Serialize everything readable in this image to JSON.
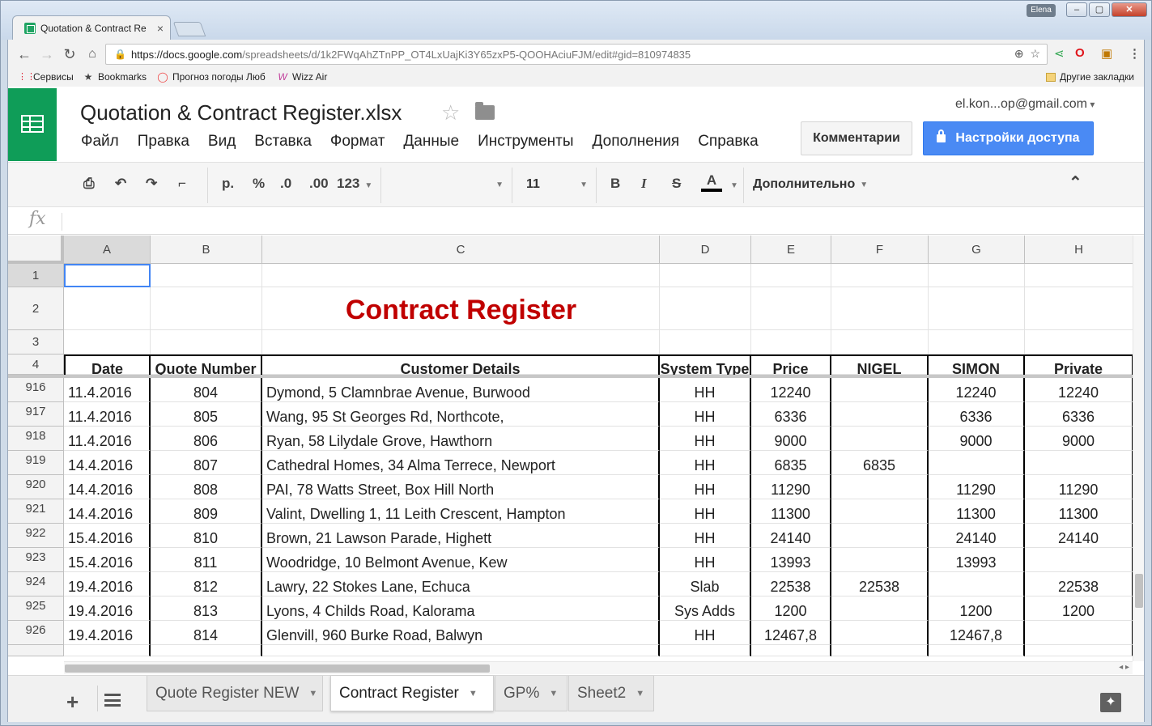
{
  "browser": {
    "tab_title": "Quotation & Contract Re",
    "tab_close": "×",
    "user_badge": "Elena",
    "min": "–",
    "max": "▢",
    "close": "✕",
    "url_host": "https://docs.google.com",
    "url_path": "/spreadsheets/d/1k2FWqAhZTnPP_OT4LxUajKi3Y65zxP5-QOOHAciuFJM/edit#gid=810974835",
    "bookmarks": [
      {
        "label": "Сервисы",
        "icon": "apps-grid-icon"
      },
      {
        "label": "Bookmarks",
        "icon": "star-icon"
      },
      {
        "label": "Прогноз погоды Люб",
        "icon": "circle-icon"
      },
      {
        "label": "Wizz Air",
        "icon": "w-icon"
      }
    ],
    "other_bookmarks": "Другие закладки"
  },
  "doc": {
    "title": "Quotation & Contract Register.xlsx",
    "account": "el.kon...op@gmail.com",
    "menu": [
      "Файл",
      "Правка",
      "Вид",
      "Вставка",
      "Формат",
      "Данные",
      "Инструменты",
      "Дополнения",
      "Справка"
    ],
    "comments_btn": "Комментарии",
    "share_btn": "Настройки доступа"
  },
  "toolbar": {
    "currency": "р.",
    "percent": "%",
    "dec_less": ".0",
    "dec_more": ".00",
    "format": "123",
    "font": "",
    "font_size": "11",
    "bold": "B",
    "italic": "I",
    "strike": "S",
    "text_color": "A",
    "more": "Дополнительно",
    "collapse": "⌃"
  },
  "formula_bar": {
    "fx": "fx",
    "content": ""
  },
  "grid": {
    "columns": [
      "A",
      "B",
      "C",
      "D",
      "E",
      "F",
      "G",
      "H"
    ],
    "title": "Contract Register",
    "headers": [
      "Date",
      "Quote Number",
      "Customer Details",
      "System Type",
      "Price",
      "NIGEL",
      "SIMON",
      "Private"
    ],
    "frozen_rows": [
      "1",
      "2",
      "3",
      "4"
    ],
    "rows": [
      {
        "n": "916",
        "cells": [
          "11.4.2016",
          "804",
          "Dymond, 5 Clamnbrae Avenue, Burwood",
          "HH",
          "12240",
          "",
          "12240",
          "12240"
        ]
      },
      {
        "n": "917",
        "cells": [
          "11.4.2016",
          "805",
          "Wang, 95 St Georges Rd, Northcote,",
          "HH",
          "6336",
          "",
          "6336",
          "6336"
        ]
      },
      {
        "n": "918",
        "cells": [
          "11.4.2016",
          "806",
          "Ryan, 58 Lilydale Grove, Hawthorn",
          "HH",
          "9000",
          "",
          "9000",
          "9000"
        ]
      },
      {
        "n": "919",
        "cells": [
          "14.4.2016",
          "807",
          "Cathedral Homes, 34 Alma Terrece, Newport",
          "HH",
          "6835",
          "6835",
          "",
          ""
        ]
      },
      {
        "n": "920",
        "cells": [
          "14.4.2016",
          "808",
          "PAI, 78 Watts Street, Box Hill North",
          "HH",
          "11290",
          "",
          "11290",
          "11290"
        ]
      },
      {
        "n": "921",
        "cells": [
          "14.4.2016",
          "809",
          "Valint, Dwelling 1, 11 Leith Crescent, Hampton",
          "HH",
          "11300",
          "",
          "11300",
          "11300"
        ]
      },
      {
        "n": "922",
        "cells": [
          "15.4.2016",
          "810",
          "Brown, 21 Lawson Parade, Highett",
          "HH",
          "24140",
          "",
          "24140",
          "24140"
        ]
      },
      {
        "n": "923",
        "cells": [
          "15.4.2016",
          "811",
          "Woodridge, 10 Belmont Avenue, Kew",
          "HH",
          "13993",
          "",
          "13993",
          ""
        ]
      },
      {
        "n": "924",
        "cells": [
          "19.4.2016",
          "812",
          "Lawry, 22 Stokes Lane, Echuca",
          "Slab",
          "22538",
          "22538",
          "",
          "22538"
        ]
      },
      {
        "n": "925",
        "cells": [
          "19.4.2016",
          "813",
          "Lyons, 4 Childs Road, Kalorama",
          "Sys Adds",
          "1200",
          "",
          "1200",
          "1200"
        ]
      },
      {
        "n": "926",
        "cells": [
          "19.4.2016",
          "814",
          "Glenvill, 960 Burke Road, Balwyn",
          "HH",
          "12467,8",
          "",
          "12467,8",
          ""
        ]
      }
    ]
  },
  "sheets": {
    "add": "+",
    "tabs": [
      {
        "label": "Quote Register NEW",
        "active": false
      },
      {
        "label": "Contract  Register",
        "active": true
      },
      {
        "label": "GP%",
        "active": false
      },
      {
        "label": "Sheet2",
        "active": false
      }
    ]
  },
  "colors": {
    "title_red": "#c00000",
    "sheets_green": "#0f9d58",
    "share_blue": "#4a8af4",
    "selection_blue": "#4285f4"
  }
}
